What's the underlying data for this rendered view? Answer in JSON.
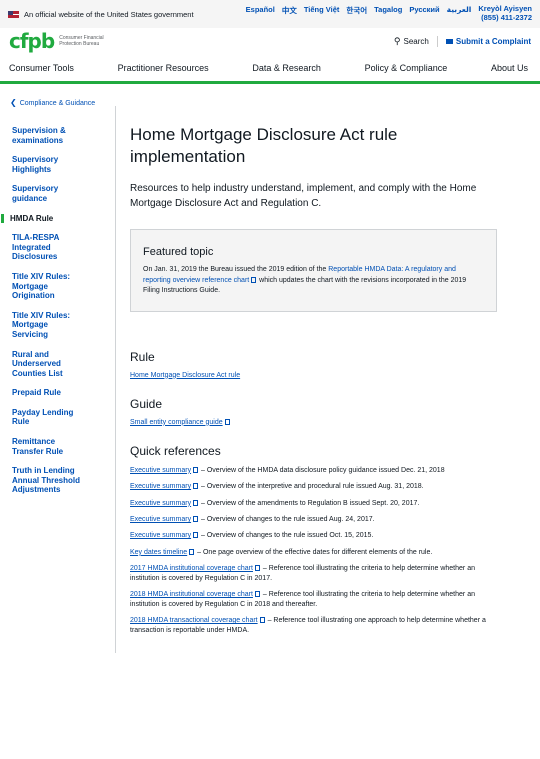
{
  "banner": {
    "text": "An official website of the United States government",
    "languages": [
      "Español",
      "中文",
      "Tiếng Việt",
      "한국어",
      "Tagalog",
      "Русский",
      "العربية"
    ],
    "last_language": "Kreyòl Ayisyen",
    "phone": "(855) 411-2372"
  },
  "header": {
    "logo_mark": "cfpb",
    "logo_text_line1": "Consumer Financial",
    "logo_text_line2": "Protection Bureau",
    "search_label": "Search",
    "complaint_label": "Submit a Complaint"
  },
  "nav": {
    "items": [
      "Consumer Tools",
      "Practitioner Resources",
      "Data & Research",
      "Policy & Compliance",
      "About Us"
    ]
  },
  "breadcrumb": {
    "label": "Compliance & Guidance"
  },
  "sidebar": {
    "items": [
      "Supervision & examinations",
      "Supervisory Highlights",
      "Supervisory guidance",
      "HMDA Rule",
      "TILA-RESPA Integrated Disclosures",
      "Title XIV Rules: Mortgage Origination",
      "Title XIV Rules: Mortgage Servicing",
      "Rural and Underserved Counties List",
      "Prepaid Rule",
      "Payday Lending Rule",
      "Remittance Transfer Rule",
      "Truth in Lending Annual Threshold Adjustments"
    ]
  },
  "main": {
    "title": "Home Mortgage Disclosure Act rule implementation",
    "lead": "Resources to help industry understand, implement, and comply with the Home Mortgage Disclosure Act and Regulation C.",
    "featured": {
      "heading": "Featured topic",
      "text_before": "On Jan. 31, 2019 the Bureau issued the 2019 edition of the ",
      "link": "Reportable HMDA Data: A regulatory and reporting overview reference chart",
      "text_after": " which updates the chart with the revisions incorporated in the 2019 Filing Instructions Guide."
    },
    "rule": {
      "heading": "Rule",
      "link": "Home Mortgage Disclosure Act rule"
    },
    "guide": {
      "heading": "Guide",
      "link": "Small entity compliance guide"
    },
    "quick_refs": {
      "heading": "Quick references",
      "items": [
        {
          "link": "Executive summary",
          "desc": " – Overview of the HMDA data disclosure policy guidance issued Dec. 21, 2018"
        },
        {
          "link": "Executive summary",
          "desc": " – Overview of the interpretive and procedural rule issued Aug. 31, 2018."
        },
        {
          "link": "Executive summary",
          "desc": " – Overview of the amendments to Regulation B issued Sept. 20, 2017."
        },
        {
          "link": "Executive summary",
          "desc": " – Overview of changes to the rule issued Aug. 24, 2017."
        },
        {
          "link": "Executive summary",
          "desc": " – Overview of changes to the rule issued Oct. 15, 2015."
        },
        {
          "link": "Key dates timeline",
          "desc": " – One page overview of the effective dates for different elements of the rule."
        },
        {
          "link": "2017 HMDA institutional coverage chart",
          "desc": " – Reference tool illustrating the criteria to help determine whether an institution is covered by Regulation C in 2017."
        },
        {
          "link": "2018 HMDA institutional coverage chart",
          "desc": " – Reference tool illustrating the criteria to help determine whether an institution is covered by Regulation C in 2018 and thereafter."
        },
        {
          "link": "2018 HMDA transactional coverage chart",
          "desc": " – Reference tool illustrating one approach to help determine whether a transaction is reportable under HMDA."
        }
      ]
    }
  },
  "colors": {
    "brand_green": "#20aa3f",
    "link_blue": "#0050b4"
  }
}
